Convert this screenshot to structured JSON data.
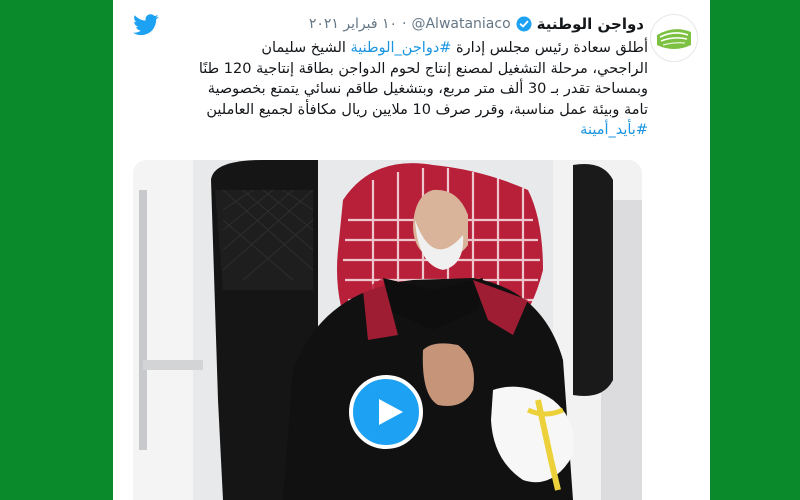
{
  "tweet": {
    "display_name": "دواجن الوطنية",
    "handle": "@Alwataniaco",
    "separator": "·",
    "date": "١٠ فبراير ٢٠٢١",
    "text_lines": [
      [
        {
          "text": "أطلق سعادة رئيس مجلس إدارة ",
          "type": "text"
        },
        {
          "text": "#دواجن_الوطنية",
          "type": "hashtag"
        },
        {
          "text": " الشيخ سليمان",
          "type": "text"
        }
      ],
      [
        {
          "text": "الراجحي، مرحلة التشغيل لمصنع إنتاج لحوم الدواجن بطاقة إنتاجية 120 طنًا",
          "type": "text"
        }
      ],
      [
        {
          "text": "وبمساحة تقدر بـ 30 ألف متر مربع، وبتشغيل طاقم نسائي يتمتع بخصوصية",
          "type": "text"
        }
      ],
      [
        {
          "text": "تامة وبيئة عمل مناسبة، وقرر صرف 10 ملايين ريال مكافأة لجميع العاملين",
          "type": "text"
        }
      ],
      [
        {
          "text": "#بأيد_أمينة",
          "type": "hashtag"
        }
      ]
    ]
  },
  "icons": {
    "brand": "twitter-bird-icon",
    "verified": "verified-badge-icon",
    "avatar": "alwatania-logo",
    "play": "play-icon"
  },
  "colors": {
    "page_background": "#0a8a2a",
    "brand_blue": "#1da1f2",
    "hashtag": "#1b95e0",
    "text": "#14171a",
    "muted": "#657786"
  }
}
